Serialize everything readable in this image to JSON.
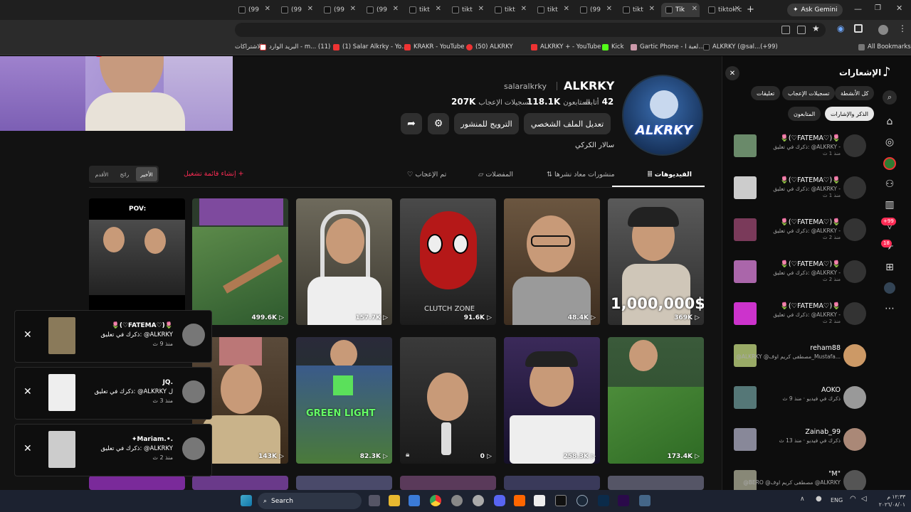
{
  "browser": {
    "tabs": [
      {
        "label": "(99"
      },
      {
        "label": "(99"
      },
      {
        "label": "(99"
      },
      {
        "label": "(99"
      },
      {
        "label": "tikt"
      },
      {
        "label": "tikt"
      },
      {
        "label": "tikt"
      },
      {
        "label": "tikt"
      },
      {
        "label": "(99"
      },
      {
        "label": "tikt"
      },
      {
        "label": "Tik"
      },
      {
        "label": "tiktok.c"
      }
    ],
    "ask_gemini": "Ask Gemini",
    "bookmarks": [
      "الاشتراكات",
      "البريد الوارد - m... (11)",
      "(1) Salar Alkrky - Yo...",
      "KRAKR - YouTube",
      "(50) ALKRKY",
      "ALKRKY + - YouTube",
      "Kick",
      "Gartic Phone - لعبة ا...",
      "ALKRKY (@sal...(+99)"
    ],
    "all_bookmarks": "All Bookmarks"
  },
  "profile": {
    "display_name": "ALKRKY",
    "username": "salaralkrky",
    "avatar_text": "ALKRKY",
    "following_count": "42",
    "following_label": "أتابعه",
    "followers_count": "118.1K",
    "followers_label": "المتابعون",
    "likes_count": "207K",
    "likes_label": "تسجيلات الإعجاب",
    "edit_profile": "تعديل الملف الشخصي",
    "promote_post": "الترويج للمنشور",
    "bio": "سالار الكركي"
  },
  "content_tabs": {
    "videos": "الفيديوهات",
    "reposts": "منشورات معاد نشرها",
    "favorites": "المفضلات",
    "liked": "تم الإعجاب",
    "sort": [
      "الأخير",
      "رائج",
      "الأقدم"
    ],
    "create_playlist": "إنشاء قائمة تشغيل"
  },
  "videos": [
    {
      "count": "369K",
      "overlay": "1,000,000$"
    },
    {
      "count": "48.4K",
      "overlay": ""
    },
    {
      "count": "91.6K",
      "overlay": "CLUTCH ZONE"
    },
    {
      "count": "157.7K",
      "overlay": ""
    },
    {
      "count": "499.6K",
      "overlay": ""
    },
    {
      "count": "",
      "overlay": "POV:"
    },
    {
      "count": "173.4K",
      "overlay": ""
    },
    {
      "count": "258.3K",
      "overlay": ""
    },
    {
      "count": "0",
      "overlay": ""
    },
    {
      "count": "82.3K",
      "overlay": "GREEN LIGHT"
    },
    {
      "count": "143K",
      "overlay": ""
    }
  ],
  "notifications": {
    "title": "الإشعارات",
    "filters": [
      "كل الأنشطة",
      "تسجيلات الإعجاب",
      "تعليقات",
      "الذكر والإشارات",
      "المتابعون"
    ],
    "items": [
      {
        "name": "🌷(♡FATEMA♡)🌷",
        "text": "ذكرك في تعليق: @ALKRKY -",
        "time": "منذ 1 ث"
      },
      {
        "name": "🌷(♡FATEMA♡)🌷",
        "text": "ذكرك في تعليق: @ALKRKY -",
        "time": "منذ 1 ث"
      },
      {
        "name": "🌷(♡FATEMA♡)🌷",
        "text": "ذكرك في تعليق: @ALKRKY -",
        "time": "منذ 2 ث"
      },
      {
        "name": "🌷(♡FATEMA♡)🌷",
        "text": "ذكرك في تعليق: @ALKRKY -",
        "time": "منذ 2 ث"
      },
      {
        "name": "🌷(♡FATEMA♡)🌷",
        "text": "ذكرك في تعليق: @ALKRKY -",
        "time": "منذ 2 ث"
      },
      {
        "name": "reham88",
        "text": "@ALKRKY @مصطفى كريم اوف_Mustafa...",
        "time": ""
      },
      {
        "name": "AOKO",
        "text": "ذكرك في فيديو · منذ 9 ث",
        "time": ""
      },
      {
        "name": "Zainab_99",
        "text": "ذكرك في فيديو · منذ 13 ث",
        "time": ""
      },
      {
        "name": "\"M\"",
        "text": "@BERO @مصطفى كريم اوف @ALKRKY",
        "time": ""
      }
    ]
  },
  "toasts": [
    {
      "name": "🌷(♡FATEMA♡)🌷",
      "text": "ذكرك في تعليق: @ALKRKY",
      "time": "منذ 9 ث"
    },
    {
      "name": "JQ.",
      "text": "ذكرك في تعليق: @ALKRKY ل",
      "time": "منذ 3 ث"
    },
    {
      "name": "✦Mariam.•.",
      "text": "ذكرك في تعليق: @ALKRKY",
      "time": "منذ 2 ث"
    }
  ],
  "side_badges": {
    "inbox": "+99",
    "messages": "18"
  },
  "taskbar": {
    "search": "Search",
    "lang": "ENG",
    "time": "١٢:٣٣ م",
    "date": "٢٠٢٦/٠٨/٠١"
  }
}
